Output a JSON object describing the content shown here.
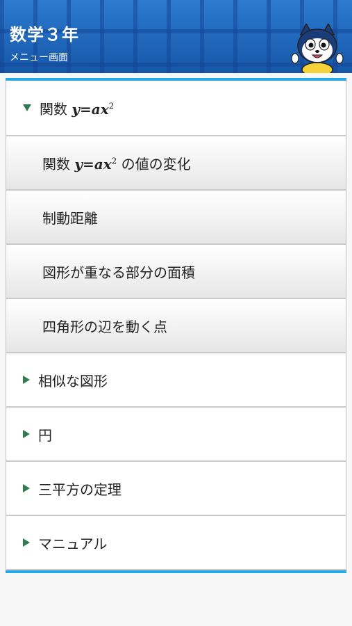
{
  "header": {
    "title": "数学３年",
    "subtitle": "メニュー画面"
  },
  "menu": {
    "expanded_section": {
      "label_prefix": "関数 ",
      "formula_base": "y=ax",
      "formula_exp": "2",
      "icon": "triangle-down-icon",
      "children": [
        {
          "prefix": "関数 ",
          "formula_base": "y=ax",
          "formula_exp": "2",
          "suffix": " の値の変化"
        },
        {
          "label": "制動距離"
        },
        {
          "label": "図形が重なる部分の面積"
        },
        {
          "label": "四角形の辺を動く点"
        }
      ]
    },
    "sections": [
      {
        "label": "相似な図形",
        "icon": "triangle-right-icon"
      },
      {
        "label": "円",
        "icon": "triangle-right-icon"
      },
      {
        "label": "三平方の定理",
        "icon": "triangle-right-icon"
      },
      {
        "label": "マニュアル",
        "icon": "triangle-right-icon"
      }
    ]
  },
  "colors": {
    "header_blue": "#1b63b8",
    "accent_cyan": "#27a8e6",
    "triangle_green": "#2e7d4e"
  }
}
